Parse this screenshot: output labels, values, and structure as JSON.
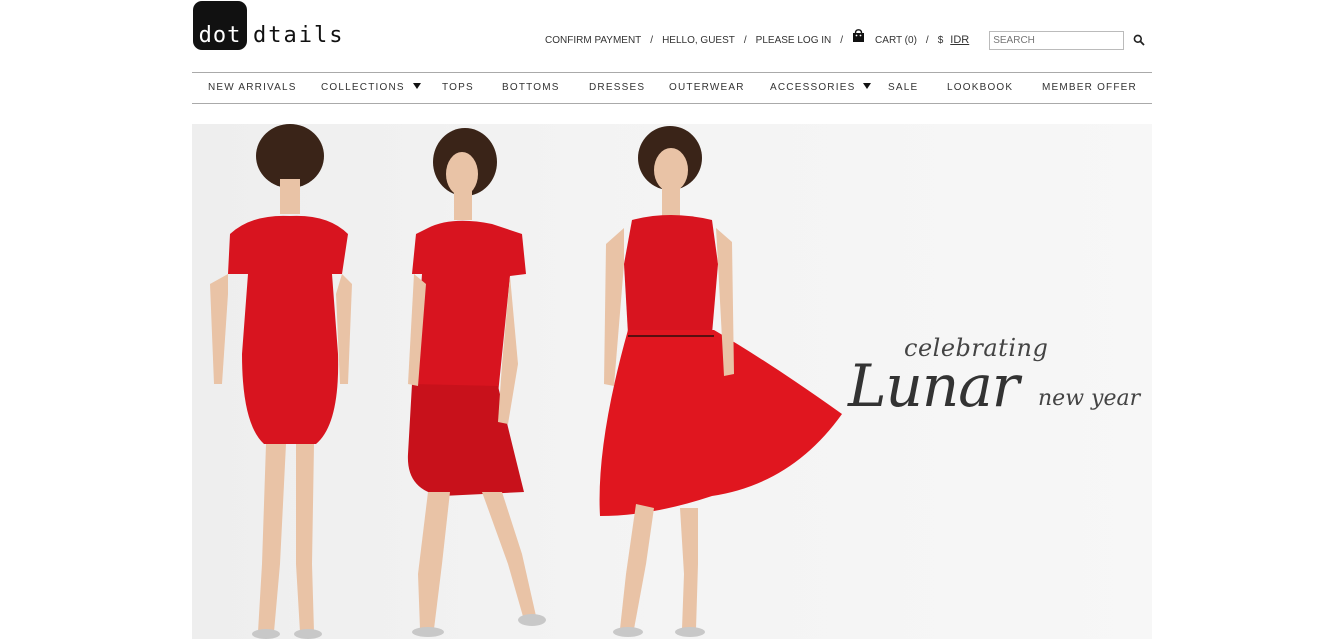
{
  "logo": {
    "box_text": "dot",
    "text": "dtails"
  },
  "utility": {
    "confirm_payment": "CONFIRM PAYMENT",
    "sep": "/",
    "hello": "HELLO, GUEST",
    "login": "PLEASE LOG IN",
    "cart": "CART (0)",
    "currency_symbol": "$",
    "currency": "IDR",
    "search_placeholder": "SEARCH",
    "icons": [
      "shopping-bag-icon",
      "search-icon"
    ]
  },
  "nav": {
    "items": [
      {
        "label": "NEW ARRIVALS",
        "dropdown": false
      },
      {
        "label": "COLLECTIONS",
        "dropdown": true
      },
      {
        "label": "TOPS",
        "dropdown": false
      },
      {
        "label": "BOTTOMS",
        "dropdown": false
      },
      {
        "label": "DRESSES",
        "dropdown": false
      },
      {
        "label": "OUTERWEAR",
        "dropdown": false
      },
      {
        "label": "ACCESSORIES",
        "dropdown": true
      },
      {
        "label": "SALE",
        "dropdown": false
      },
      {
        "label": "LOOKBOOK",
        "dropdown": false
      },
      {
        "label": "MEMBER OFFER",
        "dropdown": false
      }
    ]
  },
  "hero": {
    "line1": "celebrating",
    "line2": "Lunar",
    "line3": "new year",
    "colors": {
      "dress": "#d8141f",
      "hair": "#3a2418",
      "skin": "#e9c3a6",
      "background": "#f1f1f1"
    }
  }
}
